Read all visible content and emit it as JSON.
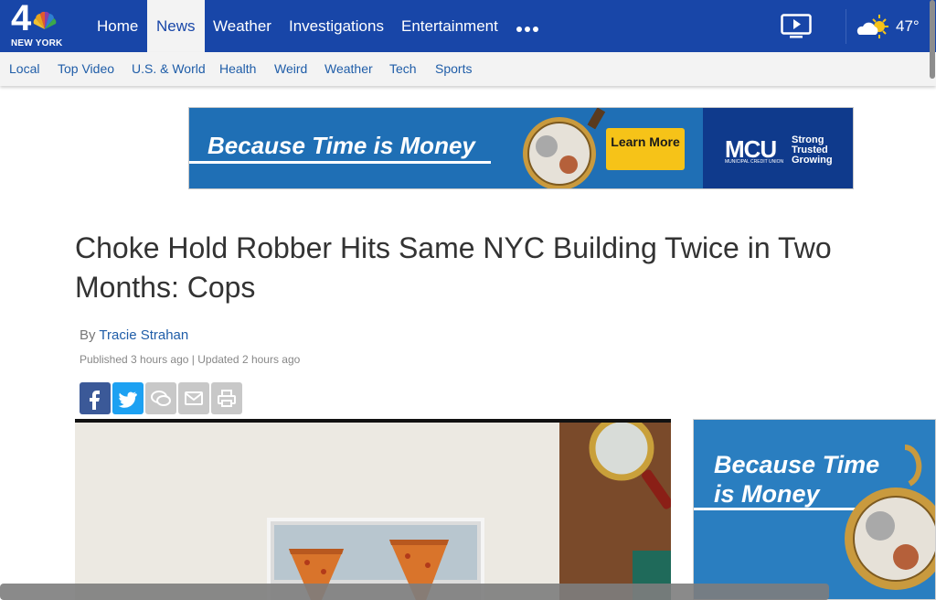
{
  "brand": {
    "channel_number": "4",
    "city": "NEW YORK"
  },
  "nav": {
    "items": [
      {
        "label": "Home",
        "active": false
      },
      {
        "label": "News",
        "active": true
      },
      {
        "label": "Weather",
        "active": false
      },
      {
        "label": "Investigations",
        "active": false
      },
      {
        "label": "Entertainment",
        "active": false
      }
    ],
    "more_icon": "more-dots-icon",
    "video_icon": "tv-play-icon",
    "weather": {
      "icon": "partly-cloudy-icon",
      "temperature": "47°"
    }
  },
  "subnav": {
    "items": [
      "Local",
      "Top Video",
      "U.S. & World",
      "Health",
      "Weird",
      "Weather",
      "Tech",
      "Sports"
    ]
  },
  "ad_top": {
    "slogan": "Because Time is Money",
    "cta": "Learn More",
    "brand": "MCU",
    "brand_sub": "MUNICIPAL CREDIT UNION",
    "tagline": [
      "Strong",
      "Trusted",
      "Growing"
    ]
  },
  "article": {
    "headline": "Choke Hold Robber Hits Same NYC Building Twice in Two Months: Cops",
    "byline_prefix": "By",
    "author": "Tracie Strahan",
    "published": "Published 3 hours ago",
    "updated": "Updated 2 hours ago",
    "separator": "|"
  },
  "share": {
    "buttons": [
      {
        "icon": "facebook-icon",
        "color": "#3b5998"
      },
      {
        "icon": "twitter-icon",
        "color": "#1da1f2"
      },
      {
        "icon": "comment-icon",
        "color": "#c8c8c8"
      },
      {
        "icon": "email-icon",
        "color": "#c8c8c8"
      },
      {
        "icon": "print-icon",
        "color": "#c8c8c8"
      }
    ]
  },
  "ad_side": {
    "line1": "Because Time",
    "line2": "is Money"
  },
  "colors": {
    "nav_blue": "#1846a8",
    "link_blue": "#1f5da8",
    "ad_yellow": "#f6c318"
  }
}
